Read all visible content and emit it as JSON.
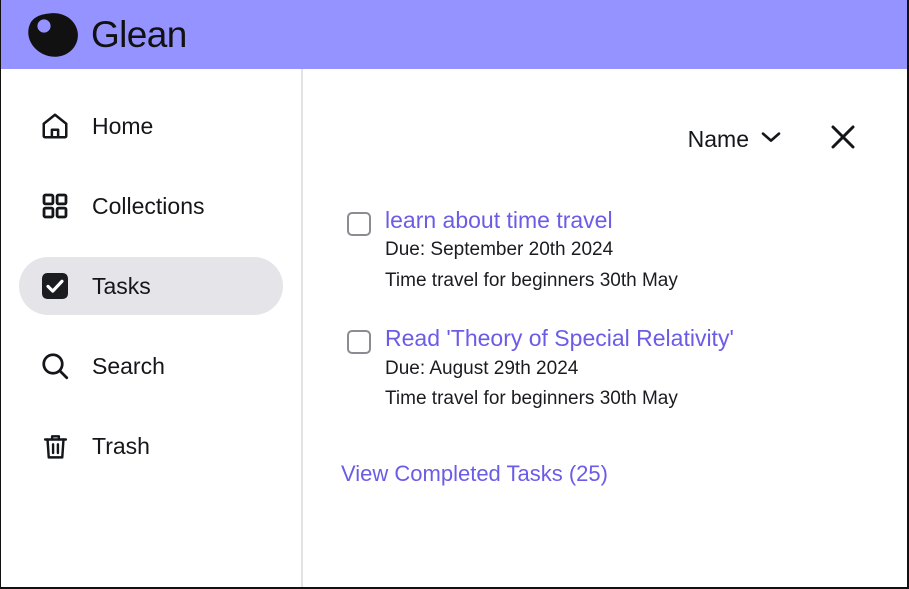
{
  "header": {
    "brand_name": "Glean",
    "logo_icon": "glean-blob-logo",
    "background_color": "#9593FF"
  },
  "sidebar": {
    "items": [
      {
        "label": "Home",
        "icon": "home-icon",
        "active": false
      },
      {
        "label": "Collections",
        "icon": "grid-icon",
        "active": false
      },
      {
        "label": "Tasks",
        "icon": "checkbox-checked-icon",
        "active": true
      },
      {
        "label": "Search",
        "icon": "search-icon",
        "active": false
      },
      {
        "label": "Trash",
        "icon": "trash-icon",
        "active": false
      }
    ],
    "active_item_background": "#E4E4E9"
  },
  "toolbar": {
    "sort_label": "Name",
    "sort_chevron_icon": "chevron-down-icon",
    "close_icon": "close-icon"
  },
  "tasks": {
    "items": [
      {
        "title": "learn about time travel",
        "due": "Due: September 20th 2024",
        "source": "Time travel for beginners 30th May",
        "checked": false
      },
      {
        "title": "Read 'Theory of Special Relativity'",
        "due": "Due: August 29th 2024",
        "source": "Time travel for beginners 30th May",
        "checked": false
      }
    ],
    "completed_link_label": "View Completed Tasks (25)",
    "link_color": "#6B5CE8"
  }
}
